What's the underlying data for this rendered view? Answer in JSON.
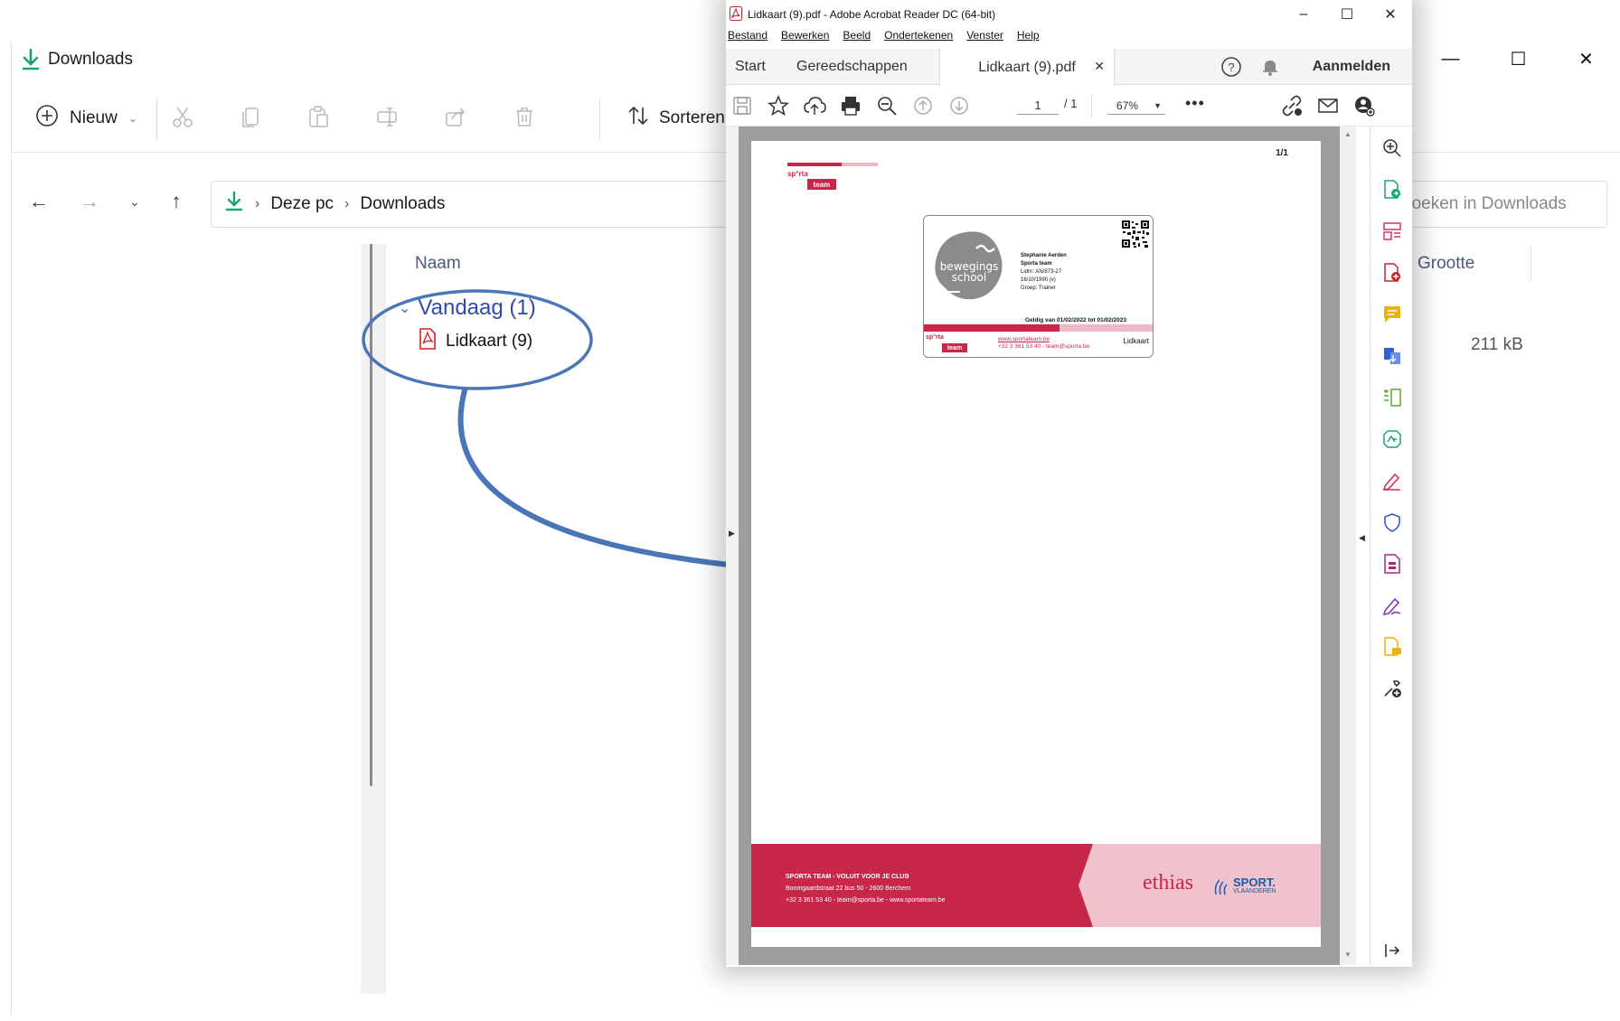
{
  "explorer": {
    "title": "Downloads",
    "toolbar": {
      "new_label": "Nieuw",
      "sort_label": "Sorteren"
    },
    "breadcrumb": [
      "Deze pc",
      "Downloads"
    ],
    "search_placeholder": "Zoeken in Downloads",
    "columns": {
      "name": "Naam",
      "size": "Grootte"
    },
    "group": {
      "label": "Vandaag (1)"
    },
    "files": [
      {
        "name": "Lidkaart (9)",
        "size": "211 kB",
        "icon": "pdf-file-icon"
      }
    ]
  },
  "acrobat": {
    "title": "Lidkaart (9).pdf - Adobe Acrobat Reader DC (64-bit)",
    "menu": [
      "Bestand",
      "Bewerken",
      "Beeld",
      "Ondertekenen",
      "Venster",
      "Help"
    ],
    "tabs": [
      {
        "label": "Start"
      },
      {
        "label": "Gereedschappen"
      },
      {
        "label": "Lidkaart (9).pdf",
        "active": true
      }
    ],
    "sign_in": "Aanmelden",
    "page_current": "1",
    "page_total": "/ 1",
    "zoom": "67%",
    "pdf": {
      "page_indicator": "1/1",
      "logo_top": "sp°rta",
      "logo_bottom": "team",
      "card": {
        "blob_text": "bewegings school",
        "holder_name": "Stephanie Aerden",
        "club": "Sporta team",
        "member_nr": "Lidnr: AN/873-27",
        "birth": "16/10/1990 (v)",
        "group": "Groep: Trainer",
        "valid": "Geldig van 01/02/2022 tot 01/02/2023",
        "url": "www.sportateam.be",
        "contact": "+32 3 361 53 40 - team@sporta.be",
        "label": "Lidkaart"
      },
      "footer": {
        "tagline": "SPORTA TEAM - VOLUIT VOOR JE CLUB",
        "address": "Boomgaardstraat 22 bus 50 - 2600 Berchem",
        "contact": "+32 3 361 53 40 - team@sporta.be - www.sportateam.be",
        "sponsor1": "ethias",
        "sponsor2": "SPORT.",
        "sponsor2_sub": "VLAANDEREN"
      }
    }
  },
  "colors": {
    "accent_blue": "#4a76b8",
    "sporta_red": "#c8274a",
    "sporta_pink": "#f0c2cc",
    "download_green": "#1aa37a"
  }
}
